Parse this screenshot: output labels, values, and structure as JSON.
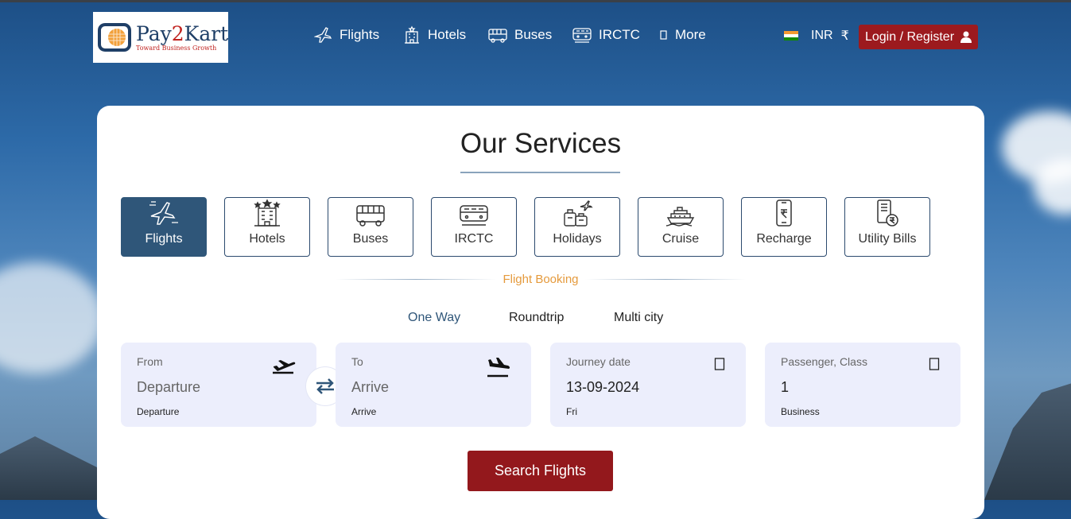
{
  "brand": {
    "name_part1": "Pay",
    "name_part2": "2",
    "name_part3": "Kart",
    "tagline": "Toward Business Growth",
    "primary_color": "#1f3f67",
    "accent_color": "#c0221f"
  },
  "nav": {
    "flights": "Flights",
    "hotels": "Hotels",
    "buses": "Buses",
    "irctc": "IRCTC",
    "more": "More"
  },
  "header": {
    "currency_code": "INR",
    "currency_symbol": "₹",
    "login_label": "Login / Register",
    "login_color": "#9c1a1e"
  },
  "main": {
    "title": "Our Services",
    "services": [
      {
        "label": "Flights",
        "icon": "plane-icon",
        "active": true
      },
      {
        "label": "Hotels",
        "icon": "hotel-icon",
        "active": false
      },
      {
        "label": "Buses",
        "icon": "bus-icon",
        "active": false
      },
      {
        "label": "IRCTC",
        "icon": "train-icon",
        "active": false
      },
      {
        "label": "Holidays",
        "icon": "holidays-icon",
        "active": false
      },
      {
        "label": "Cruise",
        "icon": "cruise-icon",
        "active": false
      },
      {
        "label": "Recharge",
        "icon": "mobile-recharge-icon",
        "active": false
      },
      {
        "label": "Utility Bills",
        "icon": "utility-bill-icon",
        "active": false
      }
    ],
    "section_label": "Flight Booking",
    "trip_types": [
      {
        "label": "One Way",
        "active": true
      },
      {
        "label": "Roundtrip",
        "active": false
      },
      {
        "label": "Multi city",
        "active": false
      }
    ],
    "fields": {
      "from": {
        "label": "From",
        "value": "Departure",
        "sub": "Departure"
      },
      "to": {
        "label": "To",
        "value": "Arrive",
        "sub": "Arrive"
      },
      "date": {
        "label": "Journey date",
        "value": "13-09-2024",
        "sub": "Fri"
      },
      "passenger": {
        "label": "Passenger, Class",
        "value": "1",
        "sub": "Business"
      }
    },
    "search_label": "Search Flights",
    "active_color": "#2f5679"
  }
}
